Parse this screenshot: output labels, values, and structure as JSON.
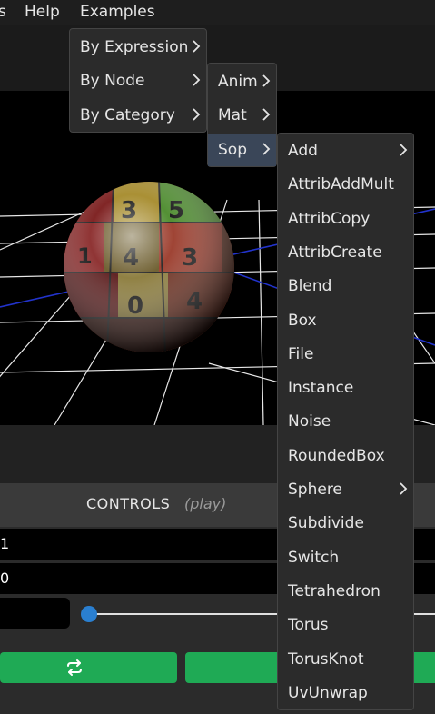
{
  "menubar": {
    "items": [
      {
        "label": "s"
      },
      {
        "label": "Help"
      },
      {
        "label": "Examples"
      }
    ]
  },
  "examples_menu": {
    "items": [
      {
        "label": "By Expression"
      },
      {
        "label": "By Node"
      },
      {
        "label": "By Category"
      }
    ]
  },
  "by_node_menu": {
    "items": [
      {
        "label": "Anim"
      },
      {
        "label": "Mat"
      },
      {
        "label": "Sop"
      }
    ]
  },
  "sop_menu": {
    "items": [
      {
        "label": "Add",
        "submenu": true
      },
      {
        "label": "AttribAddMult",
        "submenu": false
      },
      {
        "label": "AttribCopy",
        "submenu": false
      },
      {
        "label": "AttribCreate",
        "submenu": false
      },
      {
        "label": "Blend",
        "submenu": false
      },
      {
        "label": "Box",
        "submenu": false
      },
      {
        "label": "File",
        "submenu": false
      },
      {
        "label": "Instance",
        "submenu": false
      },
      {
        "label": "Noise",
        "submenu": false
      },
      {
        "label": "RoundedBox",
        "submenu": false
      },
      {
        "label": "Sphere",
        "submenu": true
      },
      {
        "label": "Subdivide",
        "submenu": false
      },
      {
        "label": "Switch",
        "submenu": false
      },
      {
        "label": "Tetrahedron",
        "submenu": false
      },
      {
        "label": "Torus",
        "submenu": false
      },
      {
        "label": "TorusKnot",
        "submenu": false
      },
      {
        "label": "UvUnwrap",
        "submenu": false
      }
    ]
  },
  "controls": {
    "title": "CONTROLS",
    "mode": "(play)",
    "field1_value": "1",
    "field2_value": "0",
    "slider_value": 0
  },
  "icons": {
    "submenu": "chevron-right-icon",
    "button": "refresh-icon"
  },
  "colors": {
    "accent_green": "#1faa55",
    "slider_blue": "#2a7fd0",
    "menu_bg": "#2b2b2b",
    "menu_highlight": "#3a4658"
  }
}
